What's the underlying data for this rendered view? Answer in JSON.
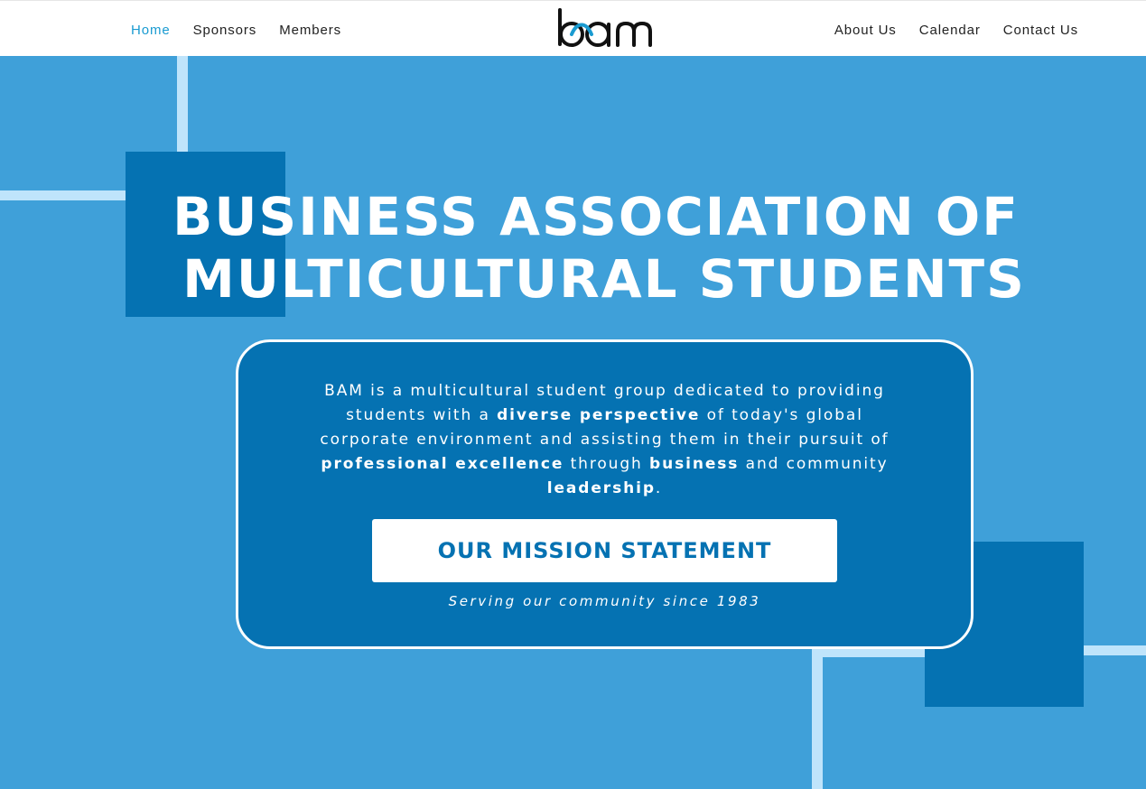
{
  "nav": {
    "left": [
      {
        "label": "Home",
        "active": true
      },
      {
        "label": "Sponsors",
        "active": false
      },
      {
        "label": "Members",
        "active": false
      }
    ],
    "right": [
      {
        "label": "About Us"
      },
      {
        "label": "Calendar"
      },
      {
        "label": "Contact Us"
      }
    ],
    "logo_text": "bam"
  },
  "hero": {
    "title_line1": "BUSINESS ASSOCIATION OF",
    "title_line2": "MULTICULTURAL STUDENTS"
  },
  "card": {
    "description": {
      "l1": "BAM is a multicultural student group dedicated to providing",
      "l2a": "students with a ",
      "l2b": "diverse perspective",
      "l2c": " of today's global",
      "l3": "corporate environment and assisting them in their pursuit of",
      "l4a": "professional excellence",
      "l4b": " through ",
      "l4c": "business",
      "l4d": " and community",
      "l5a": "leadership",
      "l5b": "."
    },
    "button_label": "OUR MISSION STATEMENT",
    "tagline": "Serving our community since 1983"
  },
  "colors": {
    "background": "#3fa0d9",
    "card": "#0572b2",
    "accent_line": "#bfe4fb",
    "active_nav": "#1a9bd1",
    "logo_accent": "#1a9bd1"
  }
}
